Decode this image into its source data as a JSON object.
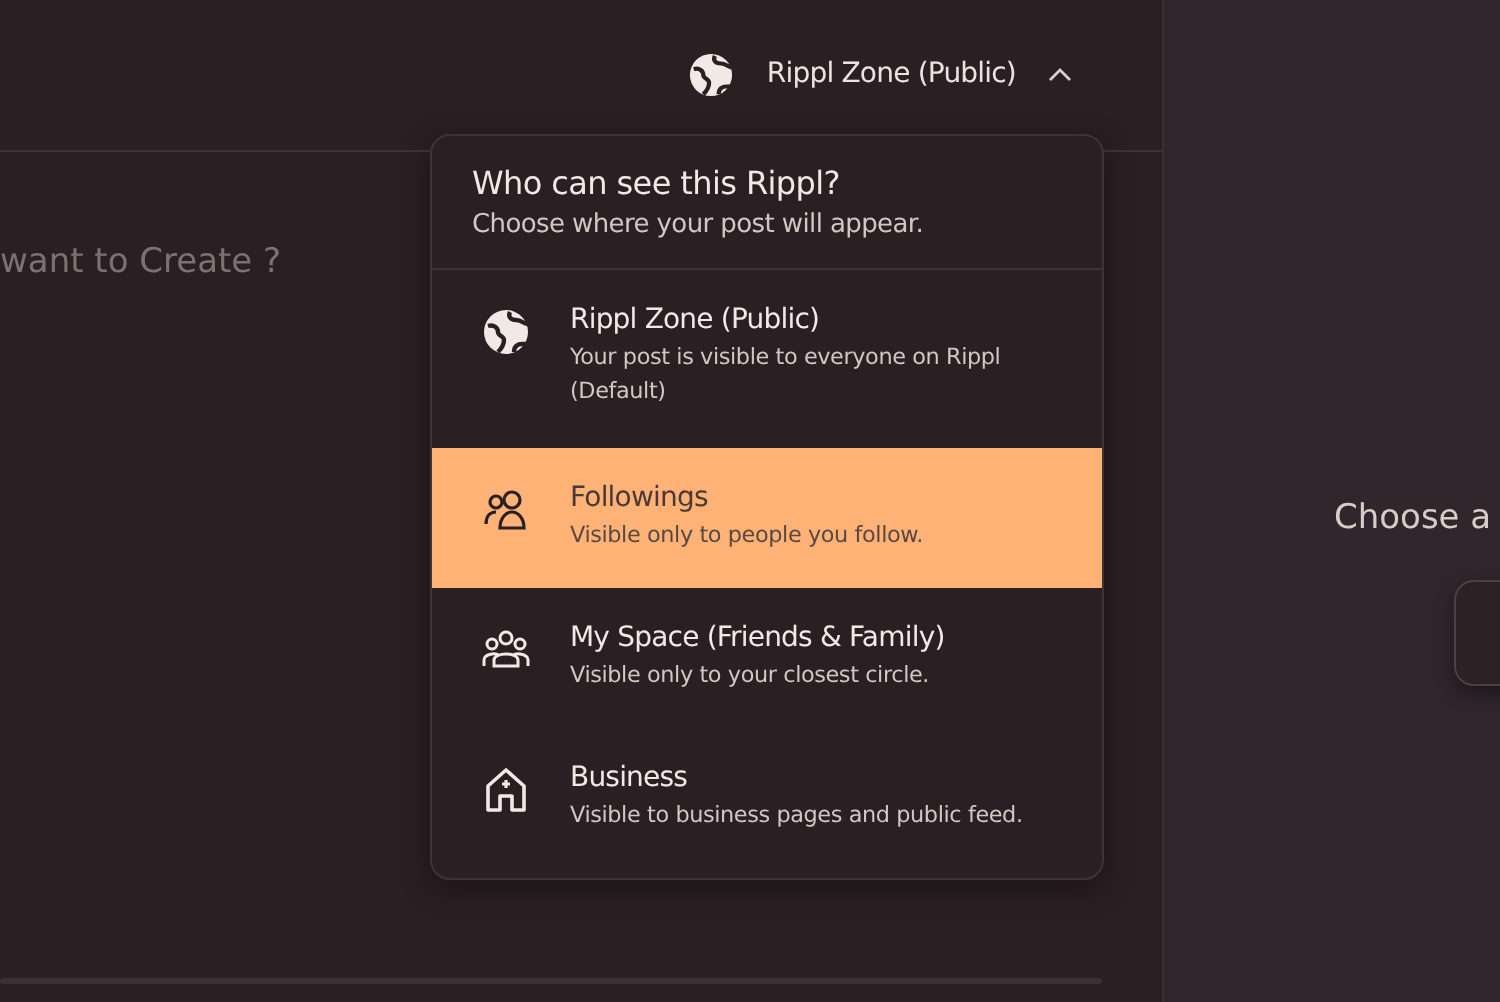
{
  "audience_button": {
    "label": "Rippl Zone (Public)",
    "expanded": true
  },
  "composer": {
    "placeholder": "want to Create ?"
  },
  "dropdown": {
    "title": "Who can see this Rippl?",
    "subtitle": "Choose where your post will appear.",
    "options": [
      {
        "kind": "globe",
        "title": "Rippl Zone (Public)",
        "description": "Your post is visible to everyone on Rippl (Default)",
        "selected": false
      },
      {
        "kind": "people",
        "title": "Followings",
        "description": "Visible only to people you follow.",
        "selected": true
      },
      {
        "kind": "group",
        "title": "My Space (Friends & Family)",
        "description": "Visible only to your closest circle.",
        "selected": false
      },
      {
        "kind": "building",
        "title": "Business",
        "description": "Visible to business pages and public feed.",
        "selected": false
      }
    ]
  },
  "side_panel": {
    "prompt": "Choose a"
  }
}
